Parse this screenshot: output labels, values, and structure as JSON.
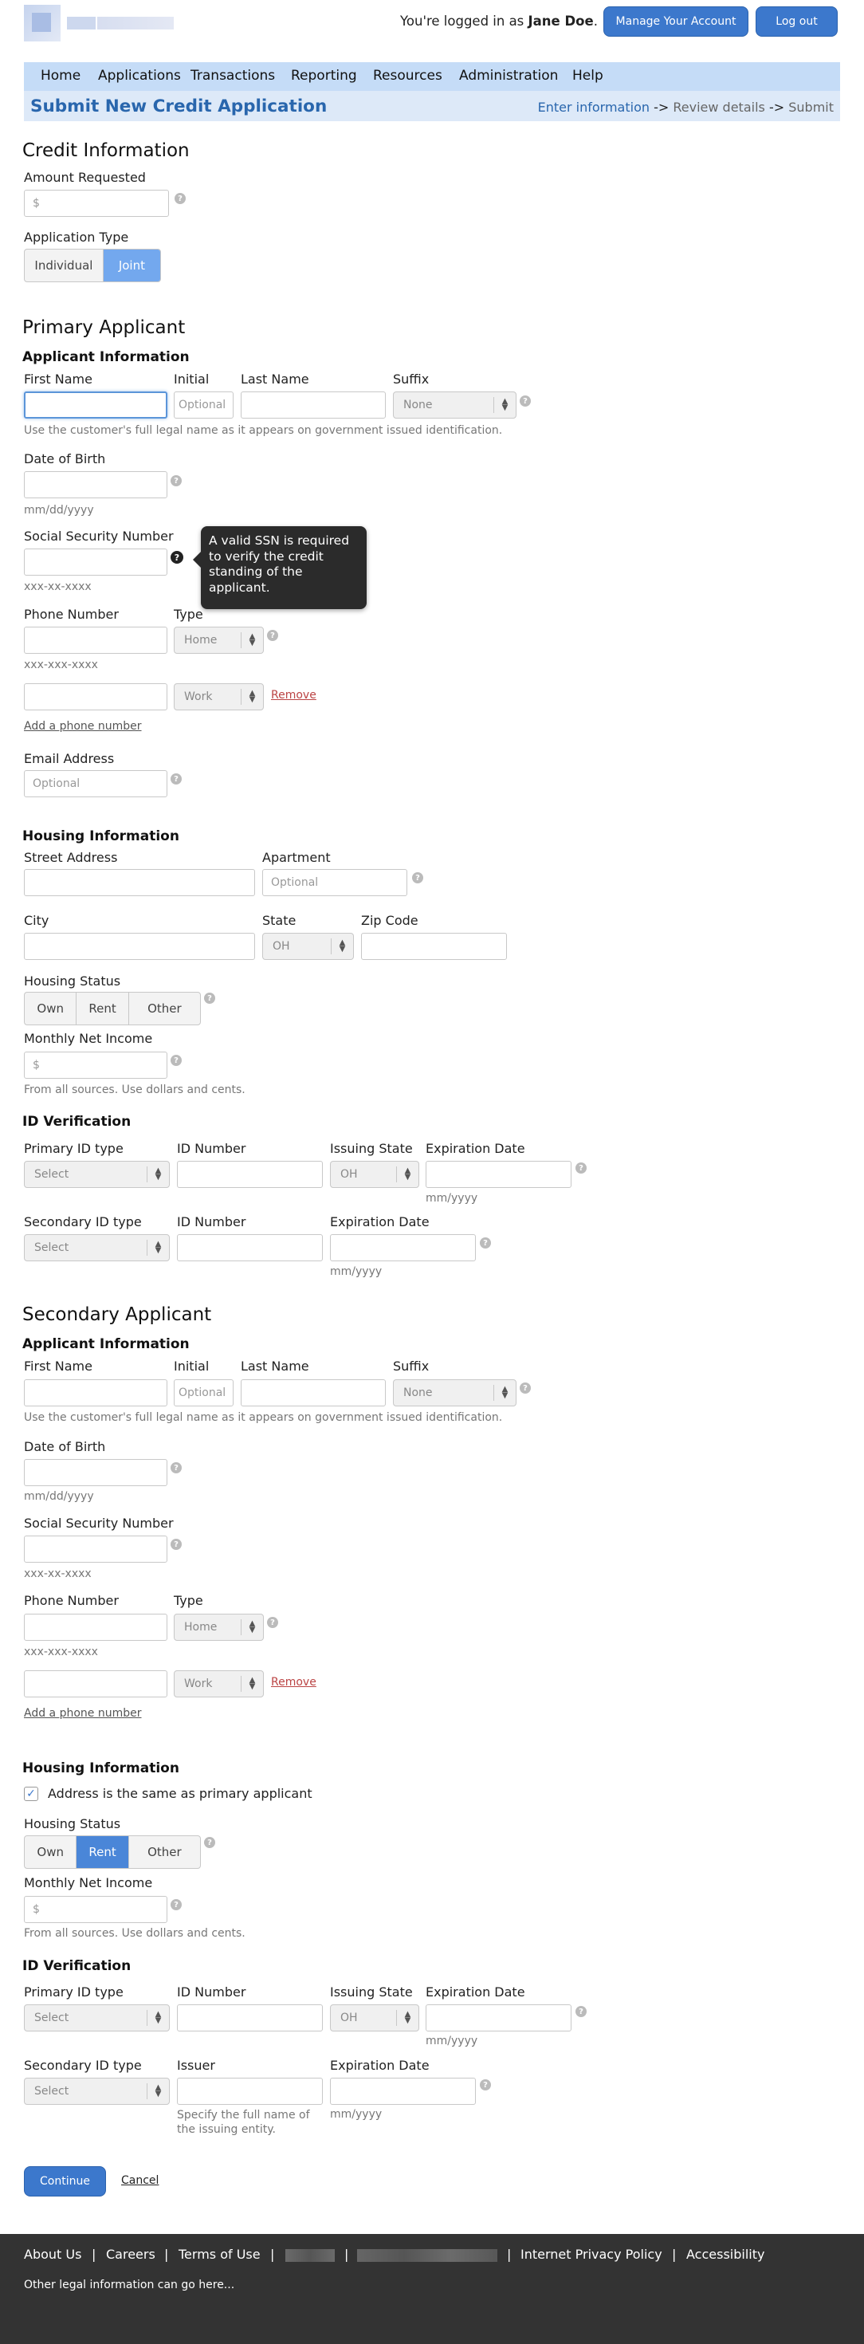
{
  "header": {
    "logged_prefix": "You're logged in as ",
    "user": "Jane Doe",
    "logged_suffix": ".",
    "manage": "Manage Your Account",
    "logout": "Log out"
  },
  "nav": [
    "Home",
    "Applications",
    "Transactions",
    "Reporting",
    "Resources",
    "Administration",
    "Help"
  ],
  "title": "Submit New Credit Application",
  "steps": {
    "s1": "Enter information",
    "arrow": "->",
    "s2": "Review details",
    "s3": "Submit"
  },
  "credit": {
    "heading": "Credit Information",
    "amount_label": "Amount Requested",
    "amount_ph": "$",
    "type_label": "Application Type",
    "types": [
      "Individual",
      "Joint"
    ]
  },
  "primary": {
    "heading": "Primary Applicant",
    "sub": "Applicant Information",
    "first": "First Name",
    "initial": "Initial",
    "last": "Last Name",
    "suffix": "Suffix",
    "initial_ph": "Optional",
    "suffix_val": "None",
    "name_hint": "Use the customer's full legal name as it appears on government issued identification.",
    "dob": "Date of Birth",
    "dob_hint": "mm/dd/yyyy",
    "ssn": "Social Security Number",
    "ssn_hint": "xxx-xx-xxxx",
    "tooltip": "A valid SSN is required to verify the credit standing of the applicant.",
    "phone": "Phone Number",
    "ptype": "Type",
    "phone_hint": "xxx-xxx-xxxx",
    "type1": "Home",
    "type2": "Work",
    "remove": "Remove",
    "add_phone": "Add a phone number",
    "email": "Email Address",
    "email_ph": "Optional"
  },
  "housing1": {
    "heading": "Housing Information",
    "street": "Street Address",
    "apt": "Apartment",
    "apt_ph": "Optional",
    "city": "City",
    "state": "State",
    "state_val": "OH",
    "zip": "Zip Code",
    "status": "Housing Status",
    "statuses": [
      "Own",
      "Rent",
      "Other"
    ],
    "income": "Monthly Net Income",
    "income_ph": "$",
    "income_hint": "From all sources. Use dollars and cents."
  },
  "id1": {
    "heading": "ID Verification",
    "ptype": "Primary ID type",
    "num": "ID Number",
    "istate": "Issuing State",
    "exp": "Expiration Date",
    "select": "Select",
    "state_val": "OH",
    "exp_hint": "mm/yyyy",
    "stype": "Secondary ID type",
    "num2": "ID Number",
    "exp2": "Expiration Date"
  },
  "secondary": {
    "heading": "Secondary Applicant",
    "sub": "Applicant Information",
    "first": "First Name",
    "initial": "Initial",
    "last": "Last Name",
    "suffix": "Suffix",
    "initial_ph": "Optional",
    "suffix_val": "None",
    "name_hint": "Use the customer's full legal name as it appears on government issued identification.",
    "dob": "Date of Birth",
    "dob_hint": "mm/dd/yyyy",
    "ssn": "Social Security Number",
    "ssn_hint": "xxx-xx-xxxx",
    "phone": "Phone Number",
    "ptype": "Type",
    "phone_hint": "xxx-xxx-xxxx",
    "type1": "Home",
    "type2": "Work",
    "remove": "Remove",
    "add_phone": "Add a phone number"
  },
  "housing2": {
    "heading": "Housing Information",
    "same": "Address is the same as primary applicant",
    "status": "Housing Status",
    "statuses": [
      "Own",
      "Rent",
      "Other"
    ],
    "income": "Monthly Net Income",
    "income_ph": "$",
    "income_hint": "From all sources. Use dollars and cents."
  },
  "id2": {
    "heading": "ID Verification",
    "ptype": "Primary ID type",
    "num": "ID Number",
    "istate": "Issuing State",
    "exp": "Expiration Date",
    "select": "Select",
    "state_val": "OH",
    "exp_hint": "mm/yyyy",
    "stype": "Secondary ID type",
    "issuer": "Issuer",
    "issuer_hint": "Specify the full name of the issuing entity.",
    "exp2": "Expiration Date"
  },
  "actions": {
    "continue": "Continue",
    "cancel": "Cancel"
  },
  "footer": {
    "links": [
      "About Us",
      "Careers",
      "Terms of Use",
      "Internet Privacy Policy",
      "Accessibility"
    ],
    "sep": "|",
    "legal": "Other legal information can go here..."
  },
  "colors": {
    "accent": "#3c78cc",
    "navbar": "#c5dcf7",
    "titlebar": "#dde9f8",
    "footer": "#333333"
  }
}
